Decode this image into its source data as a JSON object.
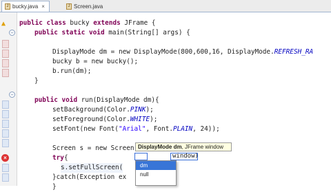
{
  "tabs": [
    {
      "label": "bucky.java",
      "active": true,
      "close": "×"
    },
    {
      "label": "Screen.java",
      "active": false,
      "close": ""
    }
  ],
  "code": {
    "l1_kw": "public class",
    "l1_rest": " bucky ",
    "l1_kw2": "extends",
    "l1_tail": " JFrame {",
    "l2_kw": "public static void",
    "l2_rest": " main(String[] args) {",
    "l3": "DisplayMode dm = new DisplayMode(800,600,16, DisplayMode.",
    "l3_field": "REFRESH_RA",
    "l4": "bucky b = new bucky();",
    "l5": "b.run(dm);",
    "l6": "}",
    "l7_kw": "public void",
    "l7_rest": " run(DisplayMode dm){",
    "l8": "setBackground(Color.",
    "l8_field": "PINK",
    "l8_tail": ");",
    "l9": "setForeground(Color.",
    "l9_field": "WHITE",
    "l9_tail": ");",
    "l10": "setFont(new Font(",
    "l10_str": "\"Arial\"",
    "l10_mid": ", Font.",
    "l10_field": "PLAIN",
    "l10_tail": ", 24));",
    "l11": "Screen s = new Screen();",
    "l12_kw": "try",
    "l12_rest": "{",
    "l13": "s.setFullScreen(",
    "l14": "}catch(Exception ex",
    "l15": "}"
  },
  "tooltip": {
    "type": "DisplayMode dm",
    "rest": ", JFrame window"
  },
  "param_box": "window)",
  "autocomplete": {
    "items": [
      "dm",
      "null"
    ],
    "selected_index": 0
  }
}
